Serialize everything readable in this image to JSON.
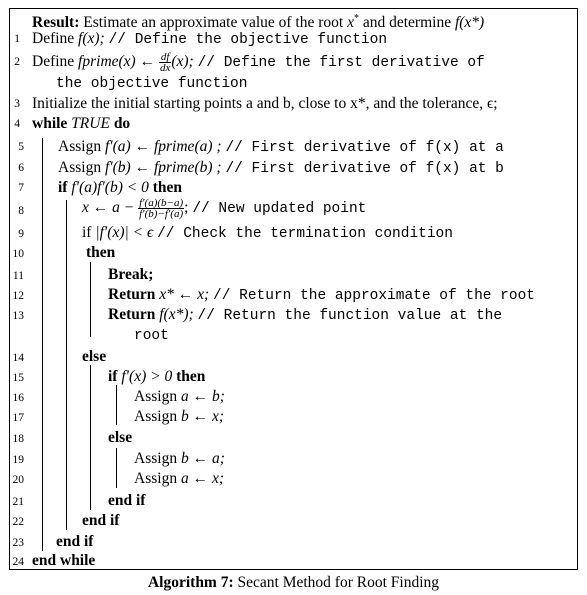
{
  "result": {
    "label": "Result:",
    "text_a": " Estimate an approximate value of the root ",
    "var_x": "x",
    "star": "*",
    "text_b": " and determine ",
    "fx": "f",
    "paren": "(x*)"
  },
  "lines": [
    {
      "n": "1",
      "kw": "Define",
      "math": "f(x);",
      "comment": "// Define the objective function"
    },
    {
      "n": "2",
      "kw": "Define",
      "math": "fprime(x) ←",
      "frac_num": "df",
      "frac_den": "dx",
      "math2": "(x);",
      "comment": "// Define the first derivative of",
      "cont": "the objective function"
    },
    {
      "n": "3",
      "text": "Initialize the initial starting points a and b, close to x*, and the tolerance, ϵ;"
    },
    {
      "n": "4",
      "kw": "while",
      "cond": "TRUE",
      "kw2": "do"
    },
    {
      "n": "5",
      "kw": "Assign",
      "math": "f′(a) ← fprime(a) ;",
      "comment": "// First derivative of f(x) at a"
    },
    {
      "n": "6",
      "kw": "Assign",
      "math": "f′(b) ← fprime(b) ;",
      "comment": "// First derivative of f(x) at b"
    },
    {
      "n": "7",
      "kw": "if",
      "cond": "f′(a)f′(b) < 0",
      "kw2": "then"
    },
    {
      "n": "8",
      "math": "x ← a −",
      "frac_num": "f′(a)(b−a)",
      "frac_den": "f′(b)−f′(a)",
      "math2": ";",
      "comment": "// New updated point"
    },
    {
      "n": "9",
      "kw": "if",
      "cond": "|f′(x)| < ϵ",
      "comment": "// Check the termination condition"
    },
    {
      "n": "10",
      "kw": "then"
    },
    {
      "n": "11",
      "kw": "Break;"
    },
    {
      "n": "12",
      "kw": "Return",
      "math": "x* ← x;",
      "comment": "// Return the approximate of the root"
    },
    {
      "n": "13",
      "kw": "Return",
      "math": "f(x*);",
      "comment": "// Return the function value at the",
      "cont": "root"
    },
    {
      "n": "14",
      "kw": "else"
    },
    {
      "n": "15",
      "kw": "if",
      "cond": "f′(x) > 0",
      "kw2": "then"
    },
    {
      "n": "16",
      "kw": "Assign",
      "math": "a ← b;"
    },
    {
      "n": "17",
      "kw": "Assign",
      "math": "b ← x;"
    },
    {
      "n": "18",
      "kw": "else"
    },
    {
      "n": "19",
      "kw": "Assign",
      "math": "b ← a;"
    },
    {
      "n": "20",
      "kw": "Assign",
      "math": "a ← x;"
    },
    {
      "n": "21",
      "kw": "end if"
    },
    {
      "n": "22",
      "kw": "end if"
    },
    {
      "n": "23",
      "kw": "end if"
    },
    {
      "n": "24",
      "kw": "end while"
    }
  ],
  "caption": {
    "label": "Algorithm 7:",
    "text": " Secant Method for Root Finding"
  }
}
